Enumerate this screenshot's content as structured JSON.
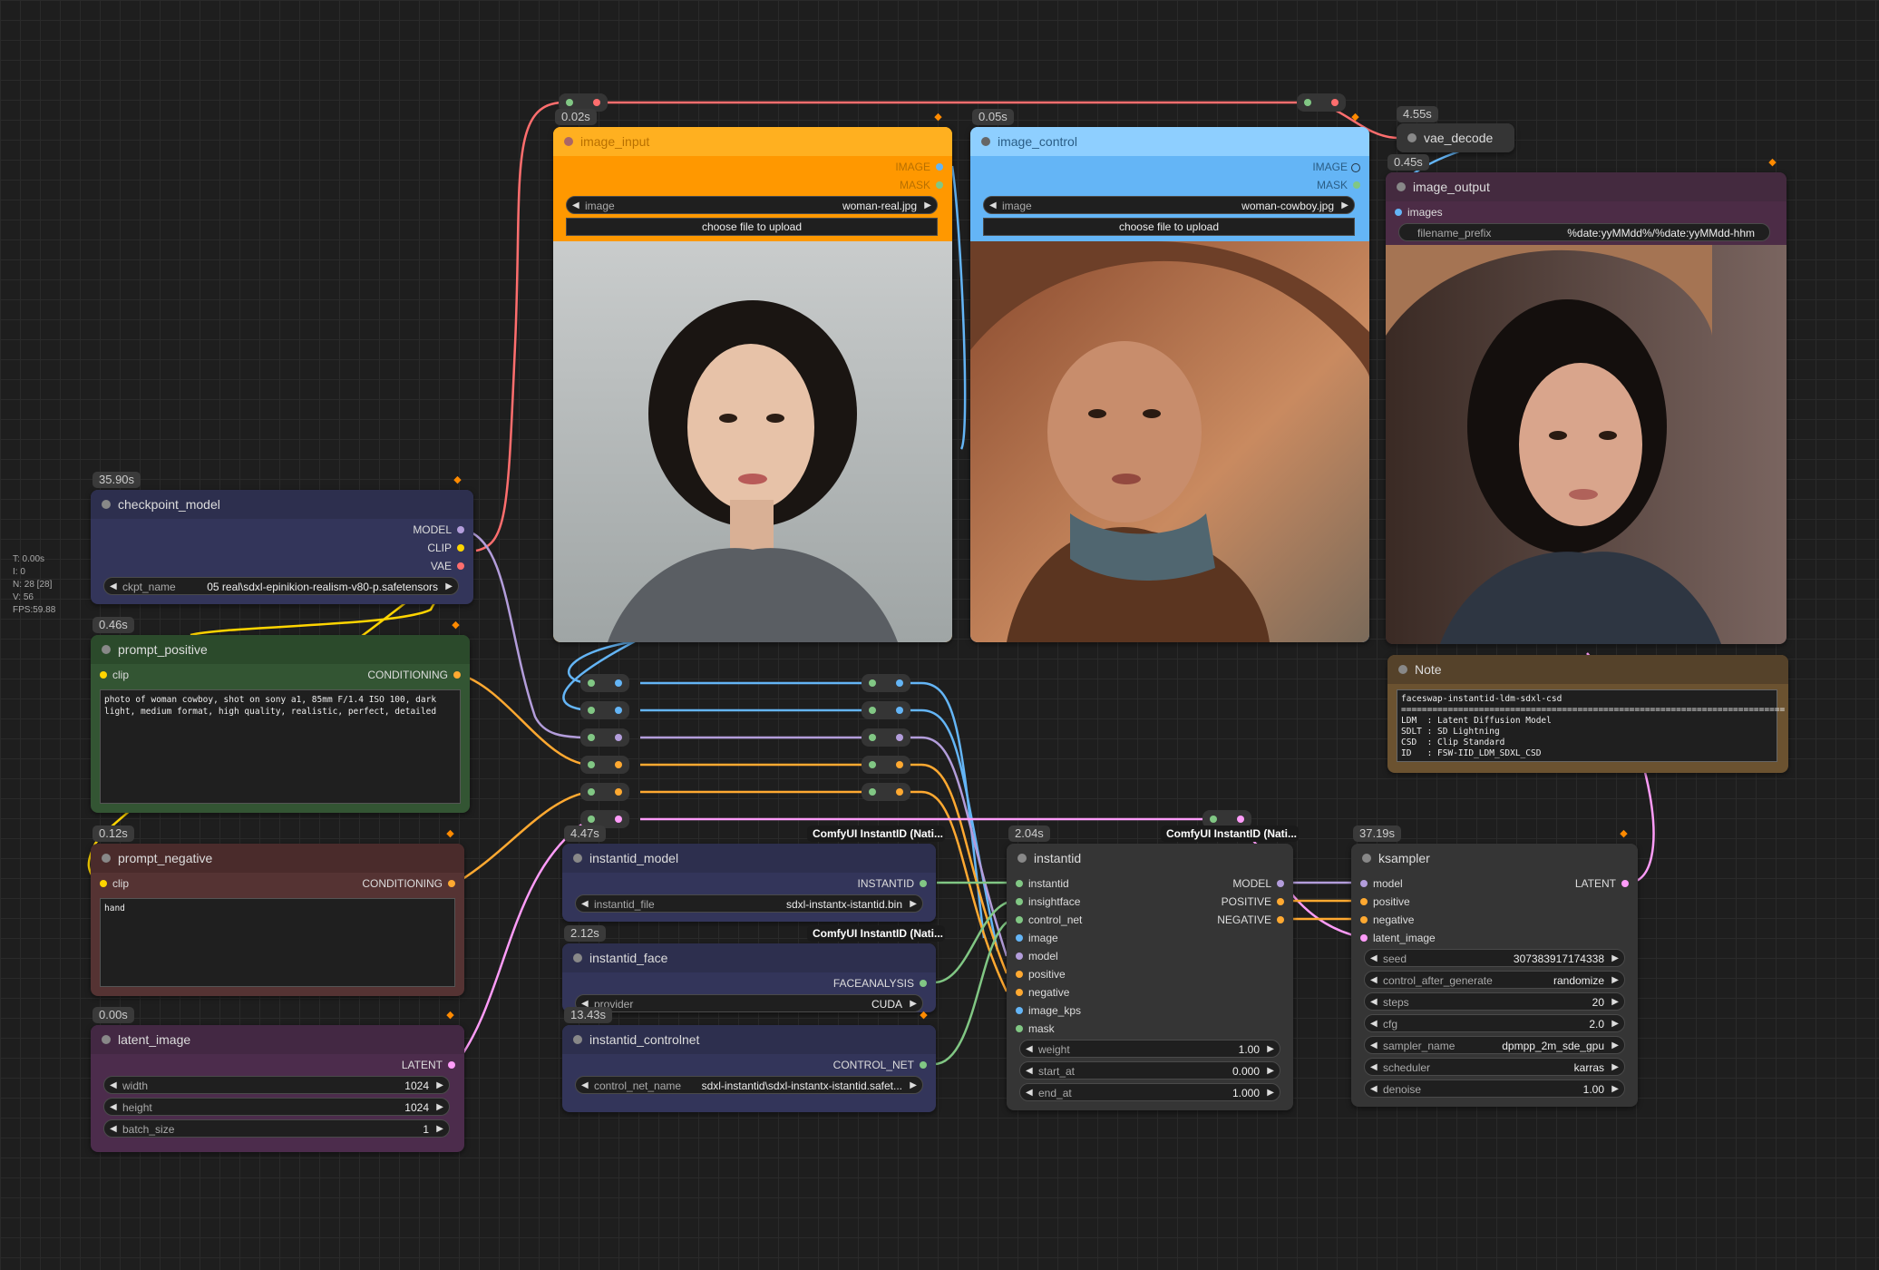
{
  "stats": [
    "T: 0.00s",
    "I: 0",
    "N: 28 [28]",
    "V: 56",
    "FPS:59.88"
  ],
  "colors": {
    "model": "#b39ddb",
    "clip": "#ffd500",
    "vae": "#ff6e6e",
    "conditioning": "#ffa931",
    "latent": "#ff9cf9",
    "image": "#64b5f6",
    "mask": "#81c784",
    "instantid": "#81c784"
  },
  "nodes": {
    "image_input": {
      "time": "0.02s",
      "title": "image_input",
      "out1": "IMAGE",
      "out2": "MASK",
      "widget_label": "image",
      "widget_value": "woman-real.jpg",
      "upload": "choose file to upload"
    },
    "image_control": {
      "time": "0.05s",
      "title": "image_control",
      "out1": "IMAGE",
      "out2": "MASK",
      "widget_label": "image",
      "widget_value": "woman-cowboy.jpg",
      "upload": "choose file to upload"
    },
    "vae_decode": {
      "time": "4.55s",
      "title": "vae_decode"
    },
    "image_output": {
      "time": "0.45s",
      "title": "image_output",
      "in1": "images",
      "widget_label": "filename_prefix",
      "widget_value": "%date:yyMMdd%/%date:yyMMdd-hhm"
    },
    "checkpoint_model": {
      "time": "35.90s",
      "title": "checkpoint_model",
      "out1": "MODEL",
      "out2": "CLIP",
      "out3": "VAE",
      "widget_label": "ckpt_name",
      "widget_value": "05 real\\sdxl-epinikion-realism-v80-p.safetensors"
    },
    "prompt_positive": {
      "time": "0.46s",
      "title": "prompt_positive",
      "in1": "clip",
      "out1": "CONDITIONING",
      "text": "photo of woman cowboy, shot on sony a1, 85mm F/1.4 ISO 100, dark light, medium format, high quality, realistic, perfect, detailed"
    },
    "prompt_negative": {
      "time": "0.12s",
      "title": "prompt_negative",
      "in1": "clip",
      "out1": "CONDITIONING",
      "text": "hand"
    },
    "latent_image": {
      "time": "0.00s",
      "title": "latent_image",
      "out1": "LATENT",
      "w1_label": "width",
      "w1_value": "1024",
      "w2_label": "height",
      "w2_value": "1024",
      "w3_label": "batch_size",
      "w3_value": "1"
    },
    "instantid_model": {
      "time": "4.47s",
      "tag": "ComfyUI InstantID (Nati...",
      "title": "instantid_model",
      "out1": "INSTANTID",
      "widget_label": "instantid_file",
      "widget_value": "sdxl-instantx-istantid.bin"
    },
    "instantid_face": {
      "time": "2.12s",
      "tag": "ComfyUI InstantID (Nati...",
      "title": "instantid_face",
      "out1": "FACEANALYSIS",
      "widget_label": "provider",
      "widget_value": "CUDA"
    },
    "instantid_controlnet": {
      "time": "13.43s",
      "title": "instantid_controlnet",
      "out1": "CONTROL_NET",
      "widget_label": "control_net_name",
      "widget_value": "sdxl-instantid\\sdxl-instantx-istantid.safet..."
    },
    "instantid": {
      "time": "2.04s",
      "tag": "ComfyUI InstantID (Nati...",
      "title": "instantid",
      "inputs": [
        "instantid",
        "insightface",
        "control_net",
        "image",
        "model",
        "positive",
        "negative",
        "image_kps",
        "mask"
      ],
      "outputs": [
        "MODEL",
        "POSITIVE",
        "NEGATIVE"
      ],
      "widgets": [
        {
          "label": "weight",
          "value": "1.00"
        },
        {
          "label": "start_at",
          "value": "0.000"
        },
        {
          "label": "end_at",
          "value": "1.000"
        }
      ]
    },
    "ksampler": {
      "time": "37.19s",
      "title": "ksampler",
      "inputs": [
        "model",
        "positive",
        "negative",
        "latent_image"
      ],
      "out1": "LATENT",
      "widgets": [
        {
          "label": "seed",
          "value": "307383917174338"
        },
        {
          "label": "control_after_generate",
          "value": "randomize"
        },
        {
          "label": "steps",
          "value": "20"
        },
        {
          "label": "cfg",
          "value": "2.0"
        },
        {
          "label": "sampler_name",
          "value": "dpmpp_2m_sde_gpu"
        },
        {
          "label": "scheduler",
          "value": "karras"
        },
        {
          "label": "denoise",
          "value": "1.00"
        }
      ]
    },
    "note": {
      "title": "Note",
      "text": "faceswap-instantid-ldm-sdxl-csd\n==========================================================================\nLDM  : Latent Diffusion Model\nSDLT : SD Lightning\nCSD  : Clip Standard\nID   : FSW-IID_LDM_SDXL_CSD"
    }
  }
}
